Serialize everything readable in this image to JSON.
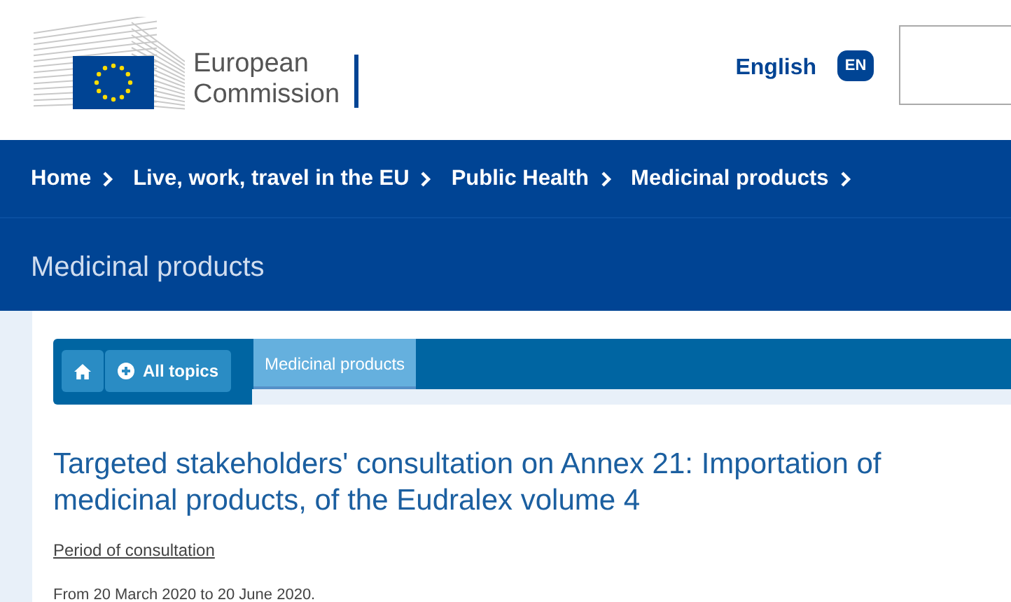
{
  "header": {
    "logo_lines": [
      "European",
      "Commission"
    ],
    "language": "English",
    "language_code": "EN"
  },
  "breadcrumbs": [
    {
      "label": "Home"
    },
    {
      "label": "Live, work, travel in the EU"
    },
    {
      "label": "Public Health"
    },
    {
      "label": "Medicinal products"
    }
  ],
  "page_title": "Medicinal products",
  "topic_nav": {
    "all_topics": "All topics",
    "tabs": [
      {
        "label": "Medicinal products",
        "selected": true
      }
    ]
  },
  "article": {
    "title": "Targeted stakeholders' consultation on Annex 21: Importation of medicinal products, of the Eudralex volume 4",
    "period_label": "Period of consultation",
    "period_text": "From 20 March 2020 to 20 June 2020."
  }
}
